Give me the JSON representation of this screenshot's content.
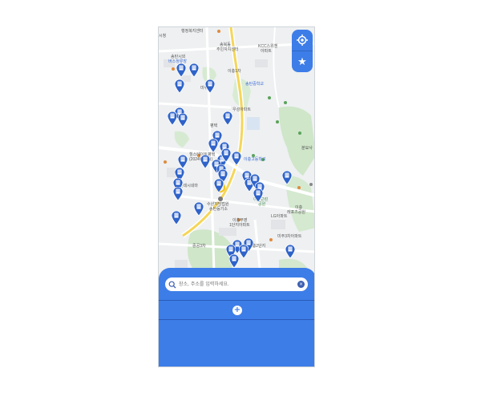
{
  "map": {
    "labels": [
      {
        "text": "행정복지센터",
        "cls": ""
      },
      {
        "text": "롯데시네",
        "cls": ""
      },
      {
        "text": "송탄시외",
        "cls": ""
      },
      {
        "text": "버스정류장",
        "cls": ""
      },
      {
        "text": "KCC스위첸",
        "cls": ""
      },
      {
        "text": "아파트",
        "cls": ""
      },
      {
        "text": "송북동",
        "cls": ""
      },
      {
        "text": "주민자치센터",
        "cls": ""
      },
      {
        "text": "이충1차",
        "cls": ""
      },
      {
        "text": "송탄중학교",
        "cls": "blue"
      },
      {
        "text": "미주1차",
        "cls": ""
      },
      {
        "text": "우성아파트",
        "cls": ""
      },
      {
        "text": "평택",
        "cls": ""
      },
      {
        "text": "이충고등학교",
        "cls": "blue"
      },
      {
        "text": "힐스테이트평택",
        "cls": ""
      },
      {
        "text": "(2024년02월)",
        "cls": ""
      },
      {
        "text": "롯데시네마",
        "cls": ""
      },
      {
        "text": "수원지방법원",
        "cls": ""
      },
      {
        "text": "송탄등기소",
        "cls": ""
      },
      {
        "text": "이충부영",
        "cls": ""
      },
      {
        "text": "1단지아파트",
        "cls": ""
      },
      {
        "text": "LG아파트",
        "cls": ""
      },
      {
        "text": "미주3차아파트",
        "cls": ""
      },
      {
        "text": "중공3차",
        "cls": ""
      },
      {
        "text": "이충2단지",
        "cls": ""
      },
      {
        "text": "이충근린",
        "cls": "green"
      },
      {
        "text": "공원",
        "cls": "green"
      },
      {
        "text": "이충",
        "cls": ""
      },
      {
        "text": "레포츠공원",
        "cls": ""
      },
      {
        "text": "분묘사",
        "cls": ""
      }
    ]
  },
  "controls": {
    "location_label": "⌖",
    "favorites_label": "★"
  },
  "search": {
    "placeholder": "장소, 주소를 입력하세요.",
    "clear_label": "×"
  },
  "sheet": {
    "add_label": "+"
  }
}
